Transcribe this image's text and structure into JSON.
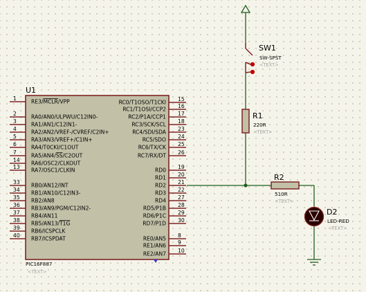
{
  "mcu": {
    "ref": "U1",
    "part": "PIC16F887",
    "text": "<TEXT>",
    "left_pins": [
      {
        "num": "1",
        "label": "RE3/MCLR/VPP",
        "overline": "MCLR"
      },
      {
        "num": "2",
        "label": "RA0/AN0/ULPWU/C12IN0-"
      },
      {
        "num": "3",
        "label": "RA1/AN1/C12IN1-"
      },
      {
        "num": "4",
        "label": "RA2/AN2/VREF-/CVREF/C2IN+"
      },
      {
        "num": "5",
        "label": "RA3/AN3/VREF+/C1IN+"
      },
      {
        "num": "6",
        "label": "RA4/T0CKI/C1OUT"
      },
      {
        "num": "7",
        "label": "RA5/AN4/SS/C2OUT",
        "overline": "SS"
      },
      {
        "num": "14",
        "label": "RA6/OSC2/CLKOUT"
      },
      {
        "num": "13",
        "label": "RA7/OSC1/CLKIN"
      },
      {
        "num": "33",
        "label": "RB0/AN12/INT"
      },
      {
        "num": "34",
        "label": "RB1/AN10/C12IN3-"
      },
      {
        "num": "35",
        "label": "RB2/AN8"
      },
      {
        "num": "36",
        "label": "RB3/AN9/PGM/C12IN2-"
      },
      {
        "num": "37",
        "label": "RB4/AN11"
      },
      {
        "num": "38",
        "label": "RB5/AN13/T1G",
        "overline": "T1G"
      },
      {
        "num": "39",
        "label": "RB6/ICSPCLK"
      },
      {
        "num": "40",
        "label": "RB7/ICSPDAT"
      }
    ],
    "right_pins": [
      {
        "num": "15",
        "label": "RC0/T1OSO/T1CKI"
      },
      {
        "num": "16",
        "label": "RC1/T1OSI/CCP2"
      },
      {
        "num": "17",
        "label": "RC2/P1A/CCP1"
      },
      {
        "num": "18",
        "label": "RC3/SCK/SCL"
      },
      {
        "num": "23",
        "label": "RC4/SDI/SDA"
      },
      {
        "num": "24",
        "label": "RC5/SDO"
      },
      {
        "num": "25",
        "label": "RC6/TX/CK"
      },
      {
        "num": "26",
        "label": "RC7/RX/DT"
      },
      {
        "num": "19",
        "label": "RD0"
      },
      {
        "num": "20",
        "label": "RD1"
      },
      {
        "num": "21",
        "label": "RD2"
      },
      {
        "num": "22",
        "label": "RD3"
      },
      {
        "num": "27",
        "label": "RD4"
      },
      {
        "num": "28",
        "label": "RD5/P1B"
      },
      {
        "num": "29",
        "label": "RD6/P1C"
      },
      {
        "num": "30",
        "label": "RD7/P1D"
      },
      {
        "num": "8",
        "label": "RE0/AN5"
      },
      {
        "num": "9",
        "label": "RE1/AN6"
      },
      {
        "num": "10",
        "label": "RE2/AN7"
      }
    ]
  },
  "sw1": {
    "ref": "SW1",
    "value": "SW-SPST",
    "text": "<TEXT>"
  },
  "r1": {
    "ref": "R1",
    "value": "220R",
    "text": "<TEXT>"
  },
  "r2": {
    "ref": "R2",
    "value": "510R",
    "text": "<TEXT>"
  },
  "d2": {
    "ref": "D2",
    "value": "LED-RED",
    "text": "<TEXT>"
  }
}
